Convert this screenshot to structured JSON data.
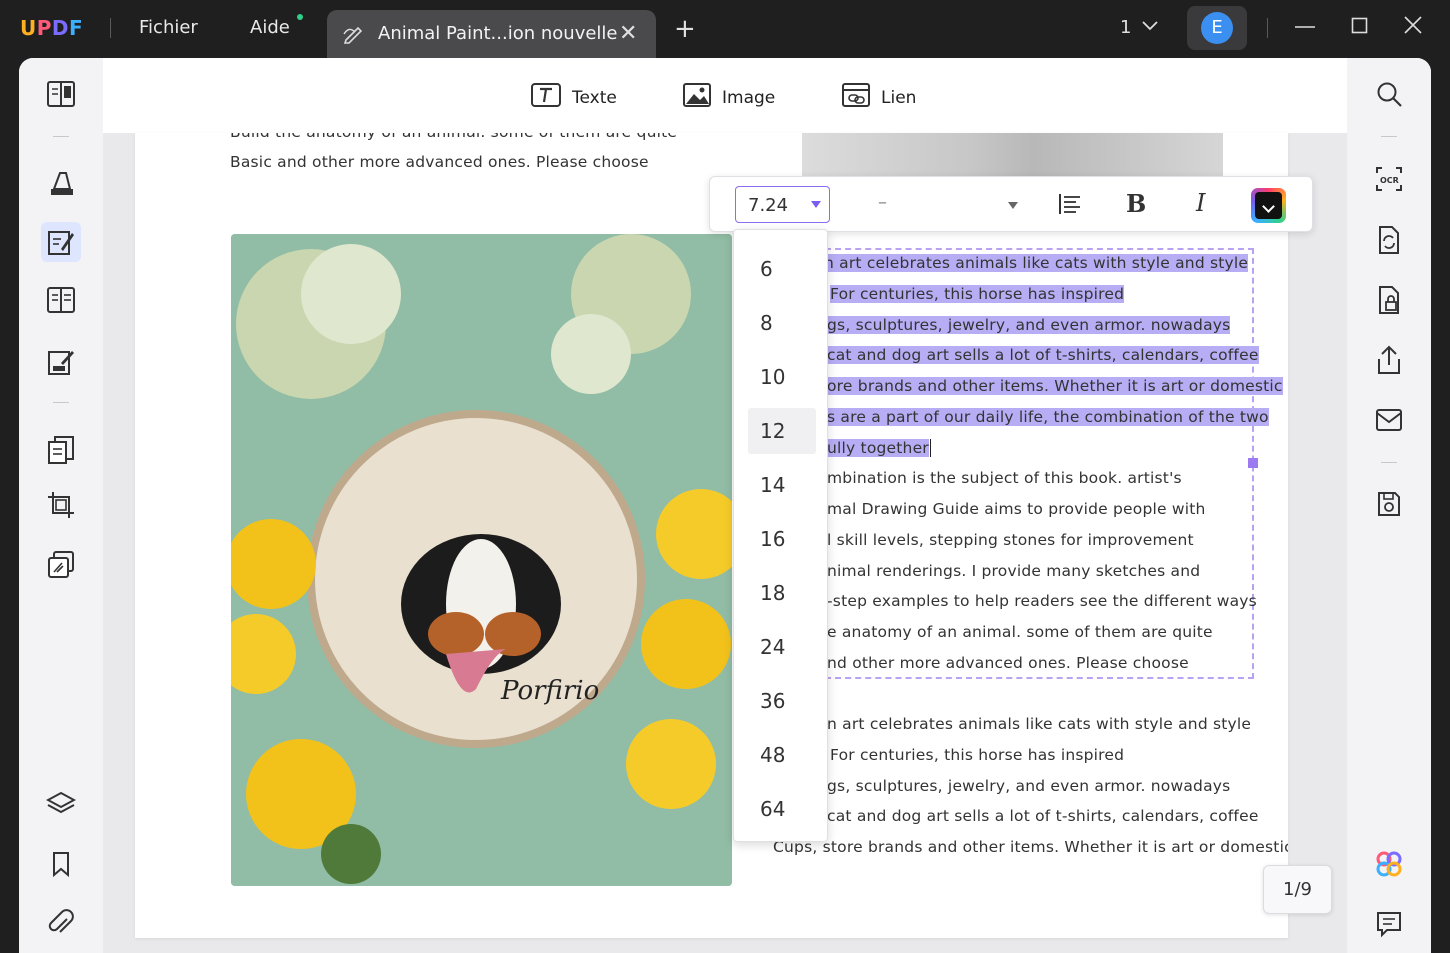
{
  "titlebar": {
    "logo": "UPDF",
    "menu": [
      "Fichier",
      "Aide"
    ],
    "tab_title": "Animal Paint...ion nouvelle",
    "page_count": "1",
    "avatar_letter": "E"
  },
  "toolbar": {
    "text_label": "Texte",
    "image_label": "Image",
    "link_label": "Lien"
  },
  "format_bar": {
    "font_size": "7.24",
    "font_family": "–"
  },
  "font_sizes": [
    "6",
    "8",
    "10",
    "12",
    "14",
    "16",
    "18",
    "24",
    "36",
    "48",
    "64"
  ],
  "font_size_highlighted": "12",
  "page": {
    "top_lines": [
      "Build the anatomy of an animal. some of them are quite",
      "Basic and other more advanced ones. Please choose"
    ],
    "selected_lines": [
      "n art celebrates animals like cats with style and style",
      "For centuries, this horse has inspired",
      "gs, sculptures, jewelry, and even armor. nowadays",
      "cat and dog art sells a lot of t-shirts, calendars, coffee",
      "ore brands and other items. Whether it is art or domestic",
      "s are a part of our daily life, the combination of the two",
      "ully together"
    ],
    "box_lines": [
      "mbination is the subject of this book. artist's",
      "mal Drawing Guide aims to provide people with",
      "l skill levels, stepping stones for improvement",
      "nimal renderings. I provide many sketches and",
      "-step examples to help readers see the different ways",
      "e anatomy of an animal. some of them are quite",
      "nd other more advanced ones. Please choose"
    ],
    "bottom_lines": [
      "n art celebrates animals like cats with style and style",
      "For centuries, this horse has inspired",
      "gs, sculptures, jewelry, and even armor. nowadays",
      "cat and dog art sells a lot of t-shirts, calendars, coffee",
      "Cups, store brands and other items. Whether it is art or domestic"
    ],
    "photo_signature": "Porfirio"
  },
  "page_indicator": "1/9"
}
